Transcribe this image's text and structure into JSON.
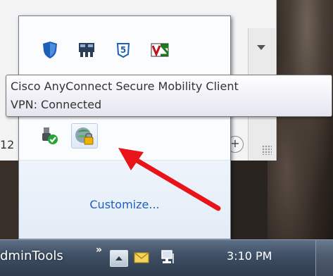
{
  "tooltip": {
    "line1": "Cisco AnyConnect Secure Mobility Client",
    "line2": "VPN: Connected"
  },
  "tray_panel": {
    "row1_icons": [
      "security-shield-icon",
      "network-device-icon",
      "s5-app-icon",
      "vnc-viewer-icon"
    ],
    "row2_icons": [
      "safely-remove-hardware-icon",
      "cisco-anyconnect-icon"
    ],
    "customize_label": "Customize..."
  },
  "background": {
    "left_number": "12"
  },
  "taskbar": {
    "toolbar_name": "dminTools",
    "chevron": "»",
    "clock": "3:10 PM"
  },
  "annotation": {
    "arrow_color": "#e8141a"
  }
}
